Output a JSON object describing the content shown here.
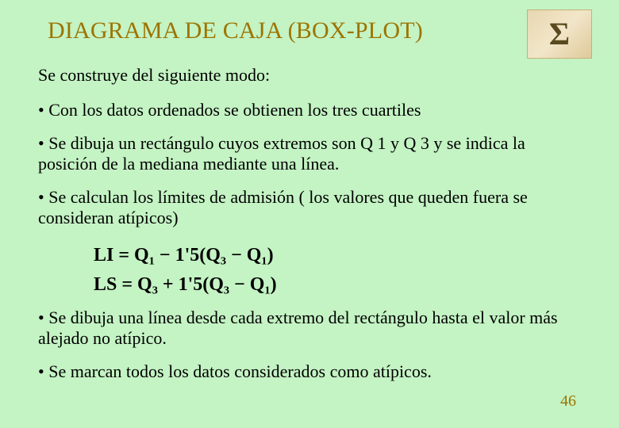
{
  "title": "DIAGRAMA DE CAJA (BOX-PLOT)",
  "sigma_icon_label": "Σ",
  "intro": "Se construye del siguiente modo:",
  "bullets": {
    "b1": "Con los datos ordenados se obtienen los tres cuartiles",
    "b2": "Se dibuja un rectángulo cuyos extremos son Q 1 y Q 3 y se indica la posición de la mediana mediante una línea.",
    "b3": "Se calculan los límites de admisión ( los valores que queden fuera se consideran atípicos)",
    "b4": "Se dibuja una línea desde cada extremo del rectángulo hasta el valor más alejado no atípico.",
    "b5": "Se marcan todos los datos considerados como atípicos."
  },
  "formulas": {
    "li": "LI = Q₁ − 1'5(Q₃ − Q₁)",
    "ls": "LS = Q₃ + 1'5(Q₃ − Q₁)"
  },
  "page_number": "46"
}
